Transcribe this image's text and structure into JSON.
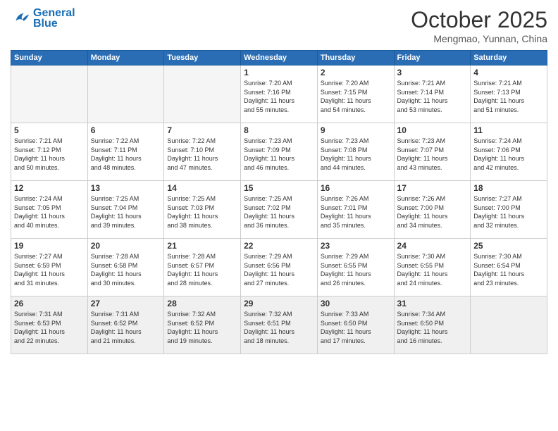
{
  "logo": {
    "line1": "General",
    "line2": "Blue"
  },
  "header": {
    "month": "October 2025",
    "location": "Mengmao, Yunnan, China"
  },
  "weekdays": [
    "Sunday",
    "Monday",
    "Tuesday",
    "Wednesday",
    "Thursday",
    "Friday",
    "Saturday"
  ],
  "weeks": [
    [
      {
        "day": "",
        "info": ""
      },
      {
        "day": "",
        "info": ""
      },
      {
        "day": "",
        "info": ""
      },
      {
        "day": "1",
        "info": "Sunrise: 7:20 AM\nSunset: 7:16 PM\nDaylight: 11 hours\nand 55 minutes."
      },
      {
        "day": "2",
        "info": "Sunrise: 7:20 AM\nSunset: 7:15 PM\nDaylight: 11 hours\nand 54 minutes."
      },
      {
        "day": "3",
        "info": "Sunrise: 7:21 AM\nSunset: 7:14 PM\nDaylight: 11 hours\nand 53 minutes."
      },
      {
        "day": "4",
        "info": "Sunrise: 7:21 AM\nSunset: 7:13 PM\nDaylight: 11 hours\nand 51 minutes."
      }
    ],
    [
      {
        "day": "5",
        "info": "Sunrise: 7:21 AM\nSunset: 7:12 PM\nDaylight: 11 hours\nand 50 minutes."
      },
      {
        "day": "6",
        "info": "Sunrise: 7:22 AM\nSunset: 7:11 PM\nDaylight: 11 hours\nand 48 minutes."
      },
      {
        "day": "7",
        "info": "Sunrise: 7:22 AM\nSunset: 7:10 PM\nDaylight: 11 hours\nand 47 minutes."
      },
      {
        "day": "8",
        "info": "Sunrise: 7:23 AM\nSunset: 7:09 PM\nDaylight: 11 hours\nand 46 minutes."
      },
      {
        "day": "9",
        "info": "Sunrise: 7:23 AM\nSunset: 7:08 PM\nDaylight: 11 hours\nand 44 minutes."
      },
      {
        "day": "10",
        "info": "Sunrise: 7:23 AM\nSunset: 7:07 PM\nDaylight: 11 hours\nand 43 minutes."
      },
      {
        "day": "11",
        "info": "Sunrise: 7:24 AM\nSunset: 7:06 PM\nDaylight: 11 hours\nand 42 minutes."
      }
    ],
    [
      {
        "day": "12",
        "info": "Sunrise: 7:24 AM\nSunset: 7:05 PM\nDaylight: 11 hours\nand 40 minutes."
      },
      {
        "day": "13",
        "info": "Sunrise: 7:25 AM\nSunset: 7:04 PM\nDaylight: 11 hours\nand 39 minutes."
      },
      {
        "day": "14",
        "info": "Sunrise: 7:25 AM\nSunset: 7:03 PM\nDaylight: 11 hours\nand 38 minutes."
      },
      {
        "day": "15",
        "info": "Sunrise: 7:25 AM\nSunset: 7:02 PM\nDaylight: 11 hours\nand 36 minutes."
      },
      {
        "day": "16",
        "info": "Sunrise: 7:26 AM\nSunset: 7:01 PM\nDaylight: 11 hours\nand 35 minutes."
      },
      {
        "day": "17",
        "info": "Sunrise: 7:26 AM\nSunset: 7:00 PM\nDaylight: 11 hours\nand 34 minutes."
      },
      {
        "day": "18",
        "info": "Sunrise: 7:27 AM\nSunset: 7:00 PM\nDaylight: 11 hours\nand 32 minutes."
      }
    ],
    [
      {
        "day": "19",
        "info": "Sunrise: 7:27 AM\nSunset: 6:59 PM\nDaylight: 11 hours\nand 31 minutes."
      },
      {
        "day": "20",
        "info": "Sunrise: 7:28 AM\nSunset: 6:58 PM\nDaylight: 11 hours\nand 30 minutes."
      },
      {
        "day": "21",
        "info": "Sunrise: 7:28 AM\nSunset: 6:57 PM\nDaylight: 11 hours\nand 28 minutes."
      },
      {
        "day": "22",
        "info": "Sunrise: 7:29 AM\nSunset: 6:56 PM\nDaylight: 11 hours\nand 27 minutes."
      },
      {
        "day": "23",
        "info": "Sunrise: 7:29 AM\nSunset: 6:55 PM\nDaylight: 11 hours\nand 26 minutes."
      },
      {
        "day": "24",
        "info": "Sunrise: 7:30 AM\nSunset: 6:55 PM\nDaylight: 11 hours\nand 24 minutes."
      },
      {
        "day": "25",
        "info": "Sunrise: 7:30 AM\nSunset: 6:54 PM\nDaylight: 11 hours\nand 23 minutes."
      }
    ],
    [
      {
        "day": "26",
        "info": "Sunrise: 7:31 AM\nSunset: 6:53 PM\nDaylight: 11 hours\nand 22 minutes."
      },
      {
        "day": "27",
        "info": "Sunrise: 7:31 AM\nSunset: 6:52 PM\nDaylight: 11 hours\nand 21 minutes."
      },
      {
        "day": "28",
        "info": "Sunrise: 7:32 AM\nSunset: 6:52 PM\nDaylight: 11 hours\nand 19 minutes."
      },
      {
        "day": "29",
        "info": "Sunrise: 7:32 AM\nSunset: 6:51 PM\nDaylight: 11 hours\nand 18 minutes."
      },
      {
        "day": "30",
        "info": "Sunrise: 7:33 AM\nSunset: 6:50 PM\nDaylight: 11 hours\nand 17 minutes."
      },
      {
        "day": "31",
        "info": "Sunrise: 7:34 AM\nSunset: 6:50 PM\nDaylight: 11 hours\nand 16 minutes."
      },
      {
        "day": "",
        "info": ""
      }
    ]
  ]
}
